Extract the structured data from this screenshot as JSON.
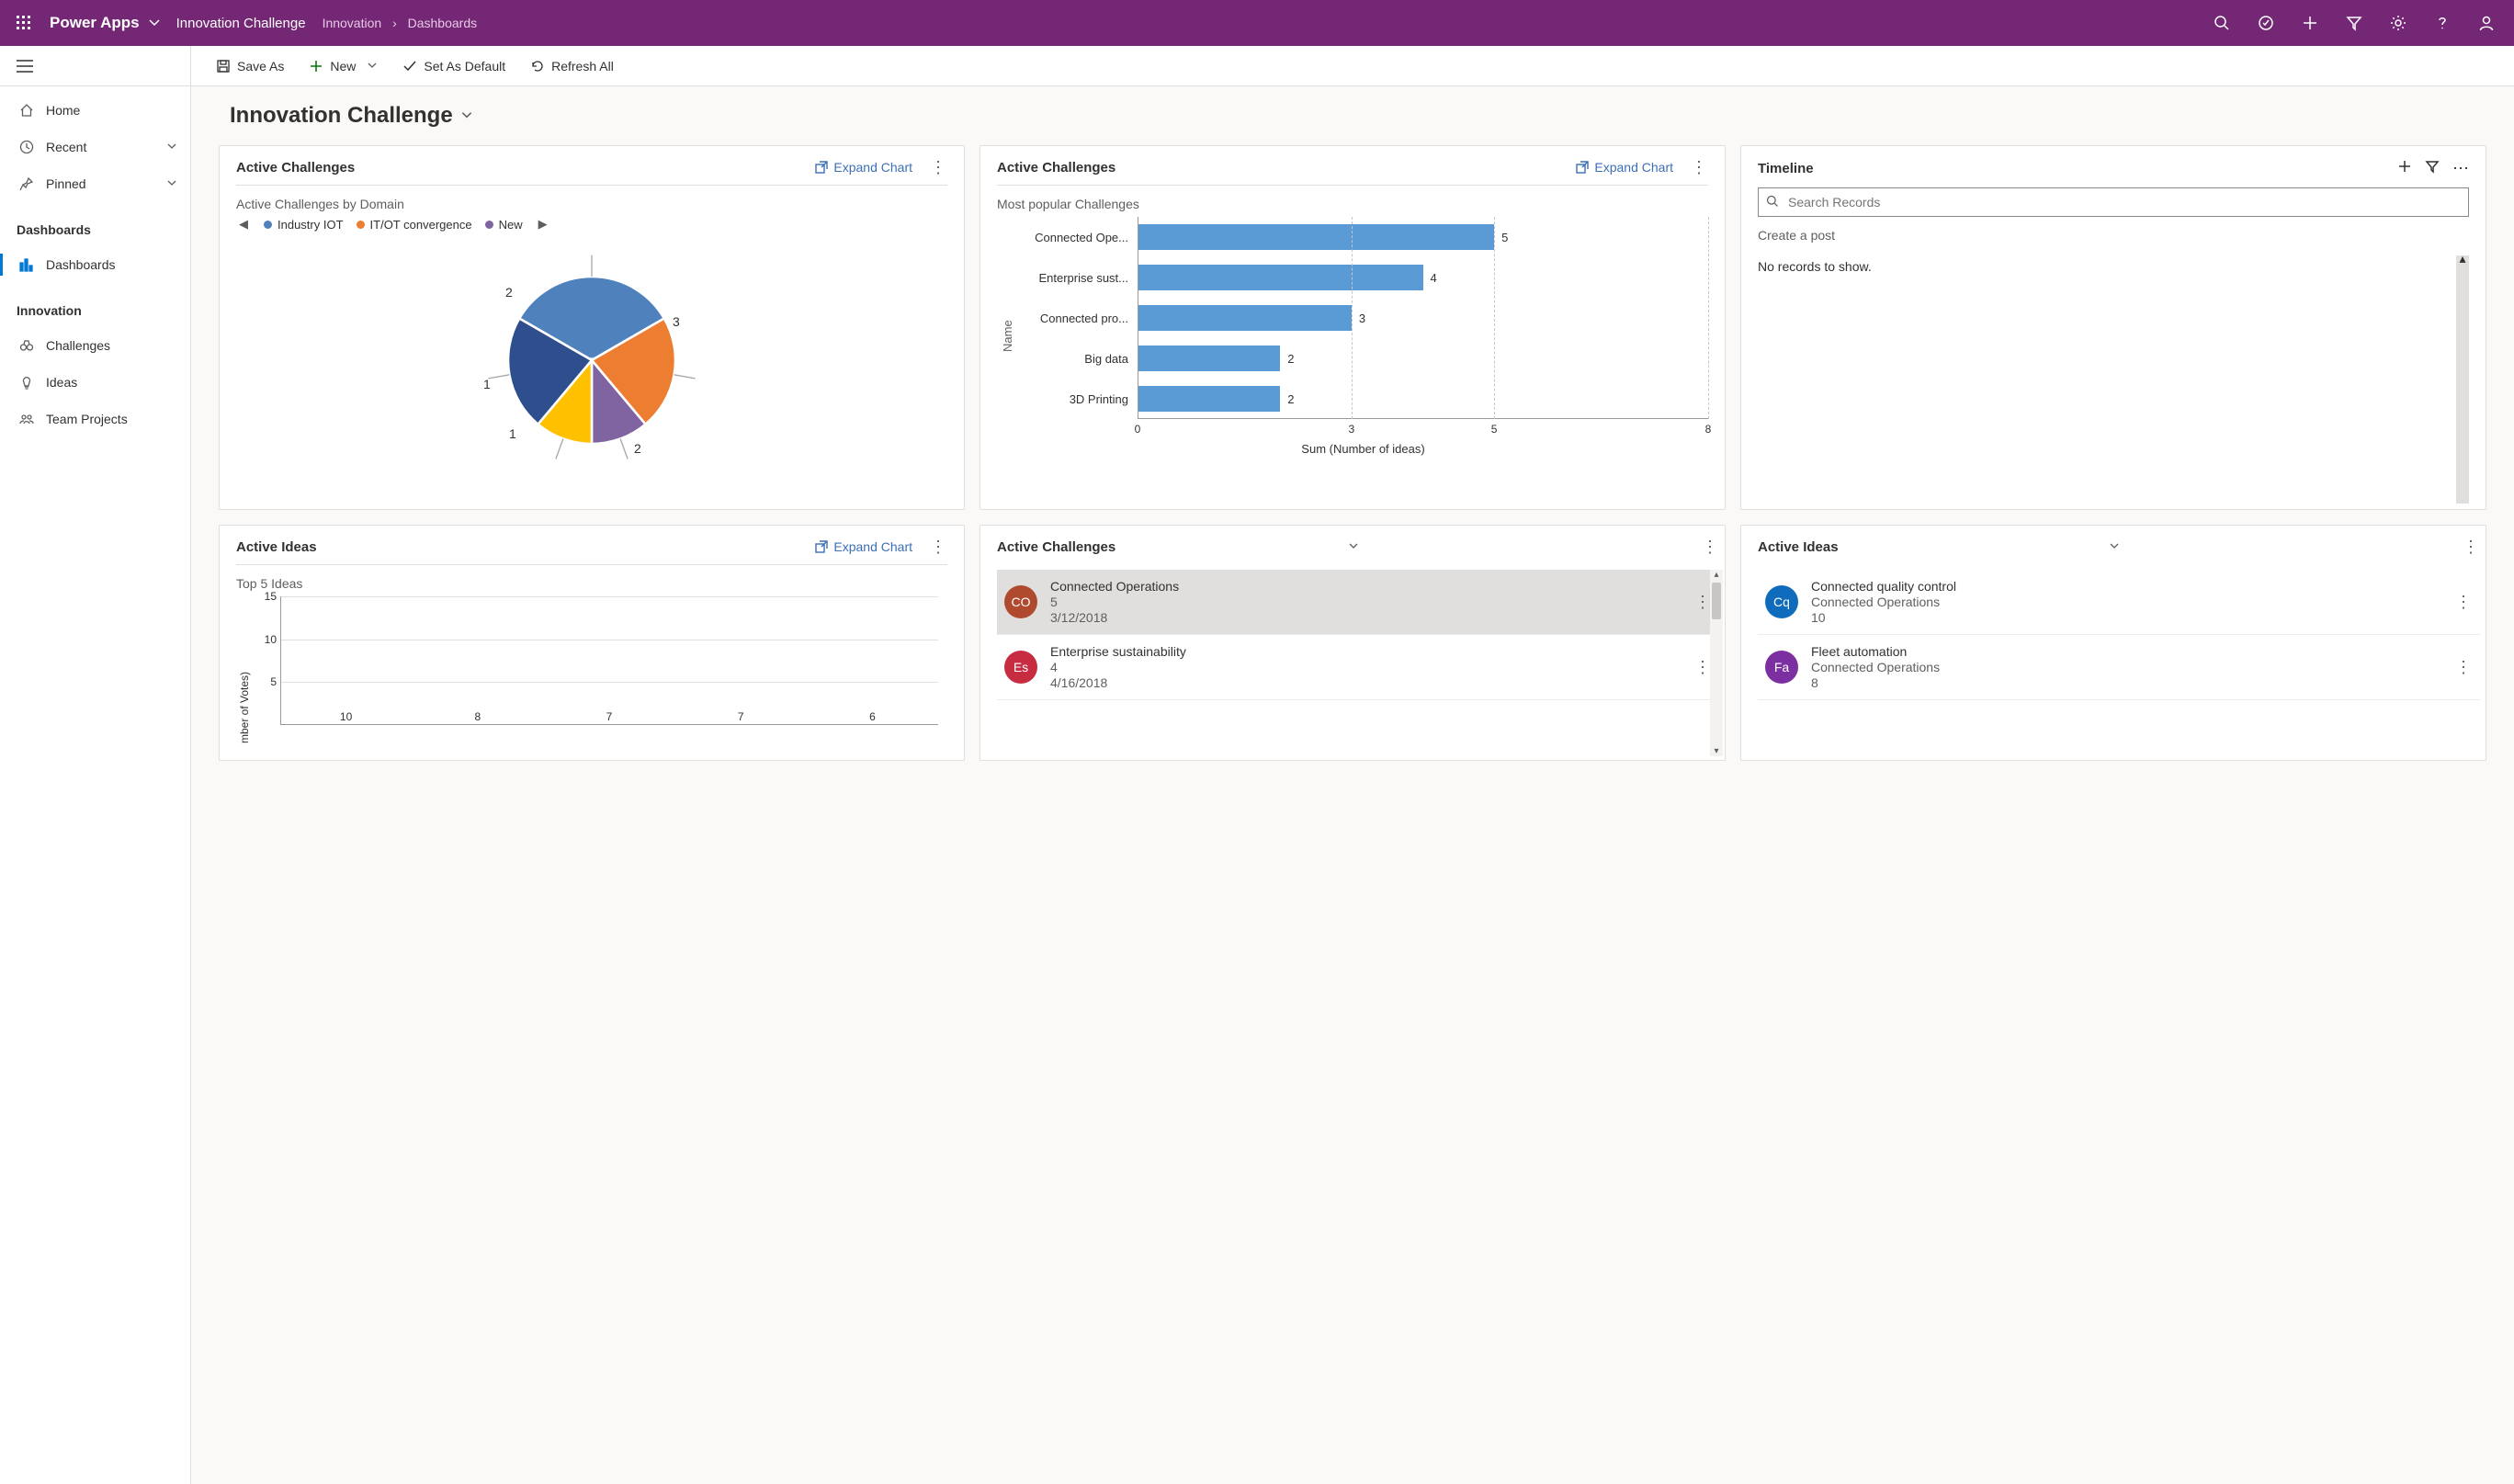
{
  "topbar": {
    "app_name": "Power Apps",
    "env_name": "Innovation Challenge",
    "breadcrumb": {
      "root": "Innovation",
      "leaf": "Dashboards"
    }
  },
  "commands": {
    "save_as": "Save As",
    "new": "New",
    "set_default": "Set As Default",
    "refresh_all": "Refresh All"
  },
  "nav": {
    "home": "Home",
    "recent": "Recent",
    "pinned": "Pinned",
    "section_dashboards": "Dashboards",
    "dashboards": "Dashboards",
    "section_innovation": "Innovation",
    "challenges": "Challenges",
    "ideas": "Ideas",
    "team_projects": "Team Projects"
  },
  "page": {
    "title": "Innovation Challenge"
  },
  "cards": {
    "pie": {
      "title": "Active Challenges",
      "expand": "Expand Chart",
      "subtitle": "Active Challenges by Domain",
      "legend": [
        "Industry IOT",
        "IT/OT convergence",
        "New"
      ]
    },
    "hbar": {
      "title": "Active Challenges",
      "expand": "Expand Chart",
      "subtitle": "Most popular Challenges",
      "ylabel": "Name",
      "xlabel": "Sum (Number of ideas)"
    },
    "timeline": {
      "title": "Timeline",
      "search_placeholder": "Search Records",
      "create_post": "Create a post",
      "no_records": "No records to show."
    },
    "vbar": {
      "title": "Active Ideas",
      "expand": "Expand Chart",
      "subtitle": "Top 5 Ideas",
      "ylabel": "mber of Votes)"
    },
    "list_challenges": {
      "title": "Active Challenges",
      "items": [
        {
          "avatar": "CO",
          "color": "#b04a2f",
          "title": "Connected Operations",
          "sub": "5",
          "date": "3/12/2018"
        },
        {
          "avatar": "Es",
          "color": "#c72c41",
          "title": "Enterprise sustainability",
          "sub": "4",
          "date": "4/16/2018"
        }
      ]
    },
    "list_ideas": {
      "title": "Active Ideas",
      "items": [
        {
          "avatar": "Cq",
          "color": "#0f6cbd",
          "title": "Connected quality control",
          "sub": "Connected Operations",
          "third": "10"
        },
        {
          "avatar": "Fa",
          "color": "#7b2fa1",
          "title": "Fleet automation",
          "sub": "Connected Operations",
          "third": "8"
        }
      ]
    }
  },
  "chart_data": [
    {
      "type": "pie",
      "title": "Active Challenges by Domain",
      "categories": [
        "Industry IOT",
        "IT/OT convergence",
        "New",
        "(purple)",
        "(yellow)"
      ],
      "values": [
        3,
        2,
        2,
        1,
        1
      ],
      "colors": [
        "#4f81bd",
        "#ed7d31",
        "#2e4e8e",
        "#8064a2",
        "#ffc000"
      ]
    },
    {
      "type": "bar",
      "orientation": "horizontal",
      "title": "Most popular Challenges",
      "xlabel": "Sum (Number of ideas)",
      "ylabel": "Name",
      "xlim": [
        0,
        8
      ],
      "xticks": [
        0,
        3,
        5,
        8
      ],
      "categories": [
        "Connected Ope...",
        "Enterprise sust...",
        "Connected pro...",
        "Big data",
        "3D Printing"
      ],
      "values": [
        5,
        4,
        3,
        2,
        2
      ]
    },
    {
      "type": "bar",
      "orientation": "vertical",
      "title": "Top 5 Ideas",
      "ylabel": "Number of Votes",
      "ylim": [
        0,
        15
      ],
      "yticks": [
        5,
        10,
        15
      ],
      "categories": [
        "",
        "",
        "",
        "",
        ""
      ],
      "values": [
        10,
        8,
        7,
        7,
        6
      ]
    }
  ]
}
